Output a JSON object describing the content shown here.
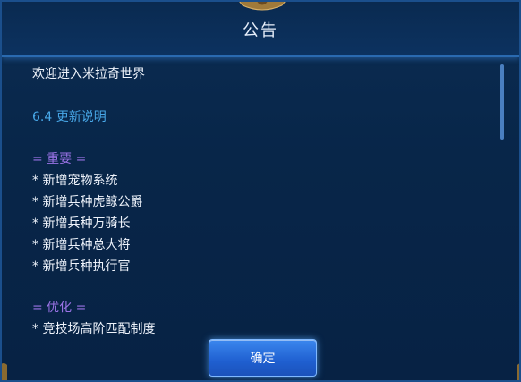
{
  "dialog": {
    "title": "公告",
    "welcome": "欢迎进入米拉奇世界",
    "version": "6.4 更新说明",
    "sections": {
      "important_header": "= 重要 =",
      "important_items": [
        "* 新增宠物系统",
        "* 新增兵种虎鲸公爵",
        "* 新增兵种万骑长",
        "* 新增兵种总大将",
        "* 新增兵种执行官"
      ],
      "optimize_header": "= 优化 =",
      "optimize_items": [
        "* 竞技场高阶匹配制度"
      ]
    },
    "confirm_label": "确定"
  },
  "colors": {
    "accent_blue": "#48a8e8",
    "section_purple": "#9a73e6",
    "button_blue": "#2a6fe0"
  }
}
